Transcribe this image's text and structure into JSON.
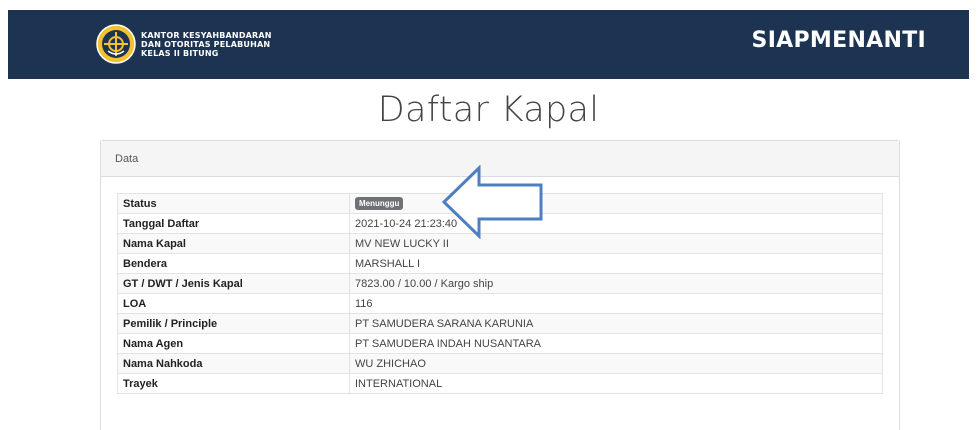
{
  "header": {
    "logo_lines": [
      "KANTOR KESYAHBANDARAN",
      "DAN OTORITAS PELABUHAN",
      "KELAS II BITUNG"
    ],
    "brand": "SIAPMENANTI",
    "colors": {
      "bar": "#1d3352",
      "emblem": "#f2c230"
    }
  },
  "page": {
    "title": "Daftar Kapal"
  },
  "panel": {
    "heading": "Data"
  },
  "details": [
    {
      "label": "Status",
      "value": "Menunggu"
    },
    {
      "label": "Tanggal Daftar",
      "value": "2021-10-24 21:23:40"
    },
    {
      "label": "Nama Kapal",
      "value": "MV NEW LUCKY II"
    },
    {
      "label": "Bendera",
      "value": "MARSHALL I"
    },
    {
      "label": "GT / DWT / Jenis Kapal",
      "value": "7823.00 / 10.00 / Kargo ship"
    },
    {
      "label": "LOA",
      "value": "116"
    },
    {
      "label": "Pemilik / Principle",
      "value": "PT SAMUDERA SARANA KARUNIA"
    },
    {
      "label": "Nama Agen",
      "value": "PT SAMUDERA INDAH NUSANTARA"
    },
    {
      "label": "Nama Nahkoda",
      "value": "WU ZHICHAO"
    },
    {
      "label": "Trayek",
      "value": "INTERNATIONAL"
    }
  ],
  "annotation": {
    "arrow_color": "#4f7fc0",
    "arrow_direction": "left"
  }
}
